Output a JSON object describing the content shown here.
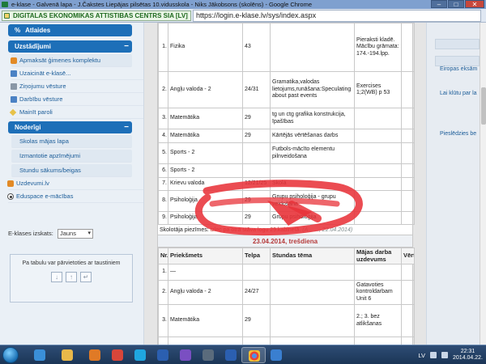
{
  "window": {
    "title": "e-klase - Galvenā lapa - J.Čakstes Liepājas pilsētas 10.vidusskola - Niks Jākobsons (skolēns) - Google Chrome",
    "buttons": {
      "minimize": "–",
      "maximize": "□",
      "close": "✕"
    }
  },
  "address_bar": {
    "site_identity": "DIGITALAS EKONOMIKAS ATTISTIBAS CENTRS SIA [LV]",
    "url": "https://login.e-klase.lv/sys/index.aspx"
  },
  "sidebar": {
    "atlaides": {
      "label": "Atlaides",
      "symbol": "%"
    },
    "settings_section": {
      "label": "Uzstādījumi",
      "toggle": "−"
    },
    "settings_items": [
      {
        "label": "Apmaksāt ģimenes komplektu",
        "icon": "coin-icon"
      },
      {
        "label": "Uzaicināt e-klasē...",
        "icon": "invite-icon"
      },
      {
        "label": "Ziņojumu vēsture",
        "icon": "message-history-icon"
      },
      {
        "label": "Darbību vēsture",
        "icon": "activity-history-icon"
      },
      {
        "label": "Mainīt paroli",
        "icon": "key-icon"
      }
    ],
    "services_section": {
      "label": "Noderīgi",
      "toggle": "−"
    },
    "services_items": [
      {
        "label": "Skolas mājas lapa"
      },
      {
        "label": "Izmantotie apzīmējumi"
      },
      {
        "label": "Stundu sākums/beigas"
      }
    ],
    "extra_items": [
      {
        "label": "Uzdevumi.lv",
        "icon": "uzdevumi-icon"
      },
      {
        "label": "Eduspace e-mācības",
        "icon": "eduspace-icon"
      }
    ],
    "scale": {
      "label": "E-klases izskats:",
      "value": "Jauns"
    },
    "reorder": {
      "text": "Pa tabulu var pārvietoties ar taustiniem",
      "left": "↓",
      "right": "↑",
      "extra": "↵"
    }
  },
  "diary": {
    "rows_top": [
      {
        "nr": "1.",
        "subject": "Fizika",
        "room": "43",
        "topic": "",
        "homework": "Pieraksti kladē. Mācību grāmata: 174.-194.lpp."
      },
      {
        "nr": "2.",
        "subject": "Angļu valoda - 2",
        "room": "24/31",
        "topic": "Gramatika,valodas lietojums,runāšana:Speculating about past events",
        "homework": "Exercises 1;2(WB) p 53"
      },
      {
        "nr": "3.",
        "subject": "Matemātika",
        "room": "29",
        "topic": "tg un ctg grafika konstrukcija, īpašības",
        "homework": ""
      },
      {
        "nr": "4.",
        "subject": "Matemātika",
        "room": "29",
        "topic": "Kārtējās vērtēšanas darbs",
        "homework": ""
      },
      {
        "nr": "5.",
        "subject": "Sports - 2",
        "room": "",
        "topic": "Futbols-mācīto elementu pilnveidošana",
        "homework": ""
      },
      {
        "nr": "6.",
        "subject": "Sports - 2",
        "room": "",
        "topic": "",
        "homework": ""
      },
      {
        "nr": "7.",
        "subject": "Krievu valoda",
        "room": "12/21/25",
        "topic": "Skola",
        "homework": ""
      },
      {
        "nr": "8.",
        "subject": "Psiholoģija",
        "room": "29",
        "topic": "Grupu psiholoģija - grupu veidošana",
        "homework": ""
      },
      {
        "nr": "9.",
        "subject": "Psiholoģija",
        "room": "29",
        "topic": "Grupu psiholoģija",
        "homework": ""
      }
    ],
    "notice": {
      "prefix": "Skolotāja piezīmes:",
      "text": "izlec pa otrā stāva logu 29.kabinetā.",
      "meta": "(A... ..., 22.04.2014)"
    },
    "day_header": "23.04.2014, trešdiena",
    "columns": {
      "nr": "Nr.",
      "subject": "Priekšmets",
      "room": "Telpa",
      "topic": "Stundas tēma",
      "homework": "Mājas darba uzdevums",
      "grade": "Vērt."
    },
    "rows_bottom": [
      {
        "nr": "1.",
        "subject": "—",
        "room": "",
        "topic": "",
        "homework": ""
      },
      {
        "nr": "2.",
        "subject": "Angļu valoda - 2",
        "room": "24/27",
        "topic": "",
        "homework": "Gatavoties kontroldarbam Unit 6"
      },
      {
        "nr": "3.",
        "subject": "Matemātika",
        "room": "29",
        "topic": "",
        "homework": "2.; 3. bez atlikšanas"
      },
      {
        "nr": "4.",
        "subject": "Matemātika",
        "room": "29",
        "topic": "",
        "homework": ""
      }
    ]
  },
  "right_panel": {
    "links": [
      "Eiropas eksām",
      "Lai klūtu par la",
      "Pieslēdzies be"
    ]
  },
  "taskbar": {
    "language": "LV",
    "time": "22:31",
    "date": "2014.04.22."
  },
  "colors": {
    "accent": "#1d6fb8",
    "annotation": "#e8333a",
    "notice": "#c0392b"
  }
}
